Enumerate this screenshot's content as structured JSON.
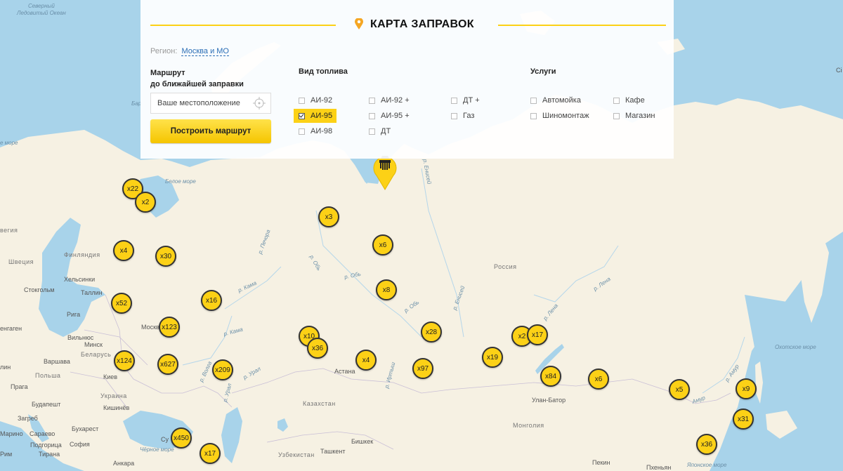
{
  "header": {
    "title": "КАРТА ЗАПРАВОК"
  },
  "region": {
    "label": "Регион:",
    "value": "Москва и МО"
  },
  "route": {
    "title_line1": "Маршрут",
    "title_line2": "до ближайшей заправки",
    "location_placeholder": "Ваше местоположение",
    "build_button": "Построить маршрут"
  },
  "fuel": {
    "title": "Вид топлива",
    "options": [
      {
        "label": "АИ-92",
        "checked": false
      },
      {
        "label": "АИ-95",
        "checked": true
      },
      {
        "label": "АИ-98",
        "checked": false
      },
      {
        "label": "АИ-92 +",
        "checked": false
      },
      {
        "label": "АИ-95 +",
        "checked": false
      },
      {
        "label": "ДТ",
        "checked": false
      },
      {
        "label": "ДТ +",
        "checked": false
      },
      {
        "label": "Газ",
        "checked": false
      }
    ]
  },
  "services": {
    "title": "Услуги",
    "options": [
      {
        "label": "Автомойка",
        "checked": false
      },
      {
        "label": "Шиномонтаж",
        "checked": false
      },
      {
        "label": "Кафе",
        "checked": false
      },
      {
        "label": "Магазин",
        "checked": false
      }
    ]
  },
  "colors": {
    "accent": "#fcd116",
    "link": "#2a6db5",
    "water": "#a8d3ea",
    "land": "#f6f1e3"
  },
  "map": {
    "clusters": [
      "x22",
      "x2",
      "x3",
      "x6",
      "x4",
      "x30",
      "x8",
      "x52",
      "x16",
      "x123",
      "x28",
      "x10",
      "x36",
      "x2",
      "x17",
      "x124",
      "x627",
      "x209",
      "x4",
      "x97",
      "x19",
      "x84",
      "x6",
      "x5",
      "x9",
      "x31",
      "x450",
      "x36",
      "x17"
    ],
    "labels": {
      "ocean_arctic": "Северный\nЛедовитый Океан",
      "sea_white": "Белое море",
      "sea_okhotsk": "Охотское море",
      "sea_black": "Чёрное море",
      "sea_japan": "Японское море",
      "sea_barents_left": "е море",
      "sea_barents_top": "Бар",
      "russia": "Россия",
      "kazakhstan": "Казахстан",
      "mongolia": "Монголия",
      "uzbekistan": "Узбекистан",
      "finland": "Финляндия",
      "sweden": "Швеция",
      "norway": "вегия",
      "belarus": "Беларусь",
      "ukraine": "Украина",
      "poland": "Польша",
      "helsinki": "Хельсинки",
      "stockholm": "Стокгольм",
      "tallinn": "Таллин",
      "riga": "Рига",
      "vilnius": "Вильнюс",
      "minsk": "Минск",
      "moscow": "Москва",
      "kyiv": "Киев",
      "warsaw": "Варшава",
      "copenhagen": "енгаген",
      "berlin": "лин",
      "prague": "Прага",
      "budapest": "Будапешт",
      "chisinau": "Кишинёв",
      "zagreb": "Загреб",
      "bucharest": "Бухарест",
      "sarajevo": "Сараево",
      "marino": "Марино",
      "podgorica": "Подгорица",
      "tirana": "Тирана",
      "sofia": "София",
      "astana": "Астана",
      "ulaanbaatar": "Улан-Батор",
      "bishkek": "Бишкек",
      "tashkent": "Ташкент",
      "ankara": "Анкара",
      "beijing": "Пекин",
      "pyongyang": "Пхеньян",
      "rim": "Рим",
      "su_partial": "Су",
      "river_pechora": "р. Печора",
      "river_ob1": "р. Обь",
      "river_ob2": "р. Обь",
      "river_ob3": "р. Обь",
      "river_kama1": "р. Кама",
      "river_kama2": "р. Кама",
      "river_volga": "р. Волга",
      "river_ural1": "р. Урал",
      "river_ural2": "р. Урал",
      "river_yenisei1": "р. Енисей",
      "river_yenisei2": "р. Енисей",
      "river_lena1": "р. Лена",
      "river_lena2": "р. Лена",
      "river_amur": "р. Амур",
      "river_irtysh": "р. Иртыш",
      "river_amur2": "Амур",
      "cl_right": "Сі"
    }
  }
}
